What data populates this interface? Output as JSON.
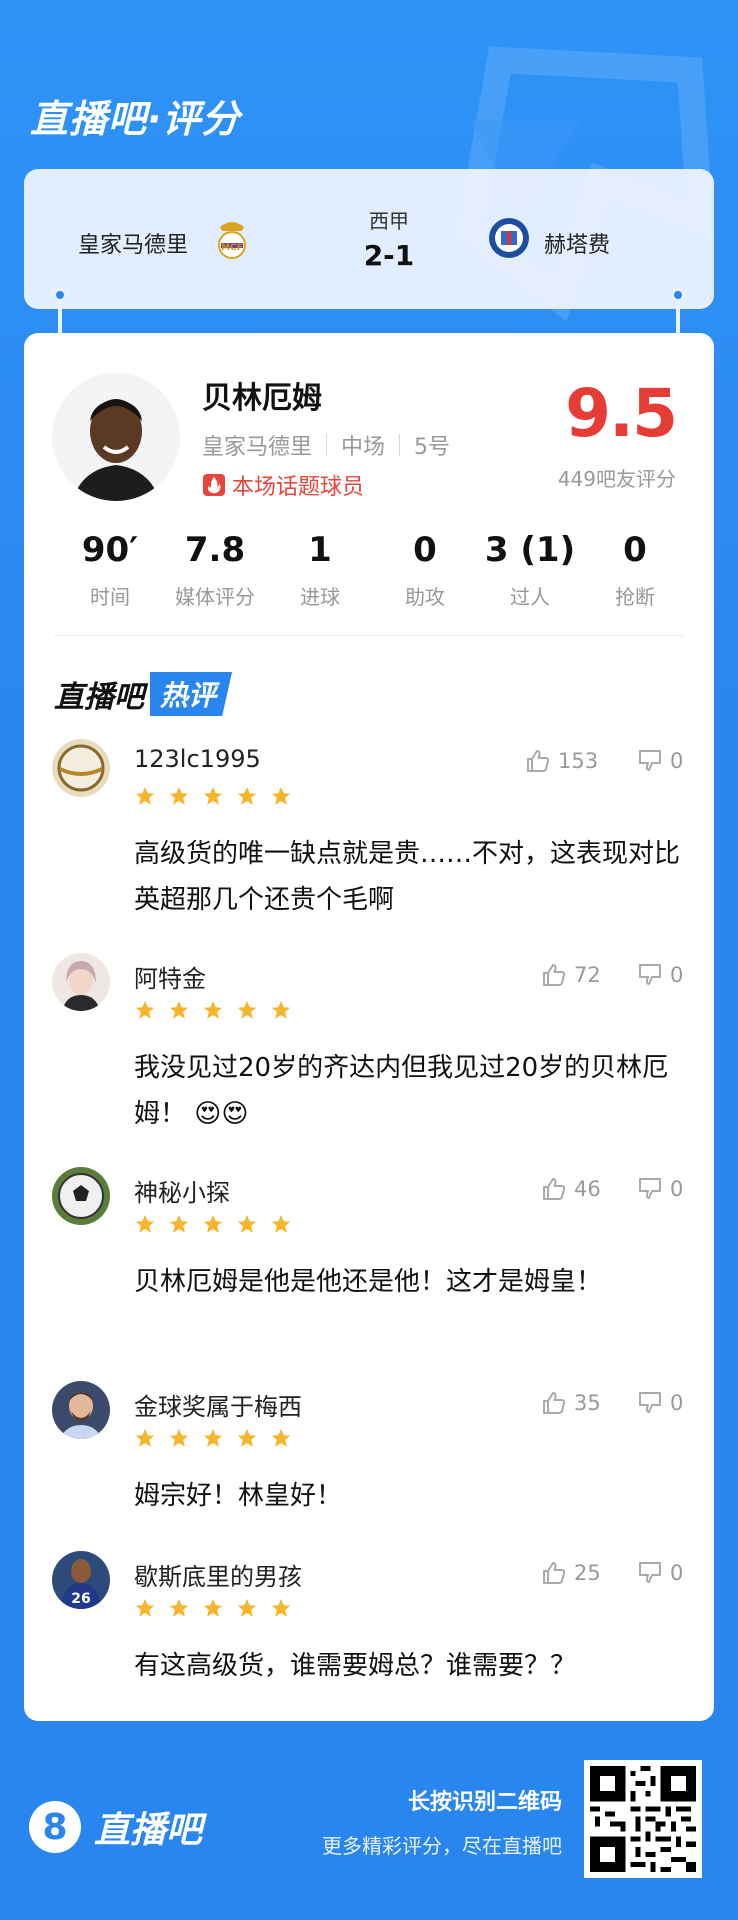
{
  "brand": {
    "title": "直播吧·评分"
  },
  "match": {
    "home_team": "皇家马德里",
    "away_team": "赫塔费",
    "league": "西甲",
    "score": "2-1"
  },
  "player": {
    "name": "贝林厄姆",
    "team": "皇家马德里",
    "position": "中场",
    "number": "5号",
    "badge": "本场话题球员",
    "rating": "9.5",
    "rating_note": "449吧友评分"
  },
  "stats": [
    {
      "value": "90′",
      "label": "时间"
    },
    {
      "value": "7.8",
      "label": "媒体评分"
    },
    {
      "value": "1",
      "label": "进球"
    },
    {
      "value": "0",
      "label": "助攻"
    },
    {
      "value": "3 (1)",
      "label": "过人"
    },
    {
      "value": "0",
      "label": "抢断"
    }
  ],
  "section": {
    "title": "直播吧",
    "tag": "热评"
  },
  "comments": [
    {
      "user": "123lc1995",
      "stars": 5,
      "likes": "153",
      "dislikes": "0",
      "text": "高级货的唯一缺点就是贵……不对，这表现对比英超那几个还贵个毛啊",
      "avatar": "ball-avatar"
    },
    {
      "user": "阿特金",
      "stars": 5,
      "likes": "72",
      "dislikes": "0",
      "text": "我没见过20岁的齐达内但我见过20岁的贝林厄姆！ 😍😍",
      "avatar": "girl-avatar"
    },
    {
      "user": "神秘小探",
      "stars": 5,
      "likes": "46",
      "dislikes": "0",
      "text": "贝林厄姆是他是他还是他！这才是姆皇！",
      "avatar": "soccer-ball-avatar"
    },
    {
      "user": "金球奖属于梅西",
      "stars": 5,
      "likes": "35",
      "dislikes": "0",
      "text": "姆宗好！林皇好！",
      "avatar": "messi-avatar"
    },
    {
      "user": "歇斯底里的男孩",
      "stars": 5,
      "likes": "25",
      "dislikes": "0",
      "text": "有这高级货，谁需要姆总？谁需要？？",
      "avatar": "jersey-26-avatar"
    }
  ],
  "footer": {
    "app_name": "直播吧",
    "tip_main": "长按识别二维码",
    "tip_sub": "更多精彩评分，尽在直播吧"
  },
  "colors": {
    "brand_blue": "#2a86ef",
    "rating_red": "#e63c36",
    "star_yellow": "#f7b52c"
  }
}
